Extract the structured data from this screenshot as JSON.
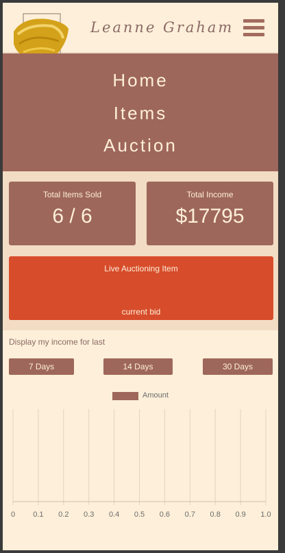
{
  "header": {
    "brand_name": "Leanne Graham"
  },
  "nav": {
    "items": [
      "Home",
      "Items",
      "Auction"
    ]
  },
  "stats": {
    "items_sold_label": "Total Items Sold",
    "items_sold_value": "6 / 6",
    "income_label": "Total Income",
    "income_value": "$17795"
  },
  "live": {
    "title": "Live Auctioning Item",
    "bid_label": "current bid"
  },
  "income_range": {
    "label": "Display my income for last",
    "buttons": [
      "7 Days",
      "14 Days",
      "30 Days"
    ]
  },
  "colors": {
    "primary": "#9e675b",
    "accent": "#d74c2b",
    "background": "#fdefd9",
    "gold": "#d4a21a"
  },
  "chart_data": {
    "type": "bar",
    "legend": [
      "Amount"
    ],
    "series": [
      {
        "name": "Amount",
        "values": []
      }
    ],
    "xticks": [
      "0",
      "0.1",
      "0.2",
      "0.3",
      "0.4",
      "0.5",
      "0.6",
      "0.7",
      "0.8",
      "0.9",
      "1.0"
    ],
    "xlim": [
      0,
      1
    ],
    "grid": true,
    "legend_position": "top"
  }
}
